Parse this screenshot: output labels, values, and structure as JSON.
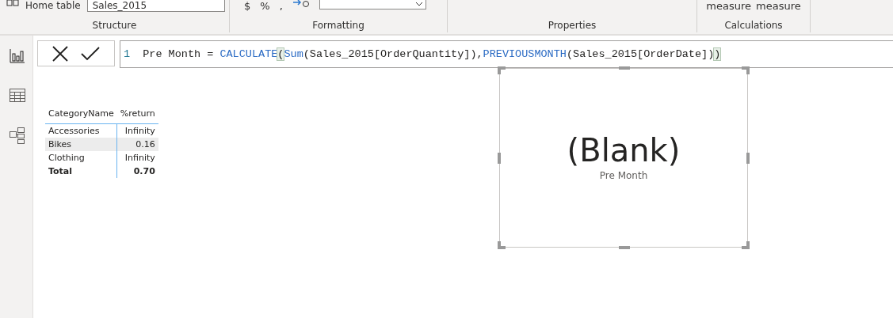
{
  "ribbon": {
    "groups": [
      {
        "kind": "structure",
        "caption": "Structure",
        "label": "Home table",
        "field_value": "Sales_2015"
      },
      {
        "kind": "formatting",
        "caption": "Formatting",
        "symbols": [
          "$",
          "%",
          ","
        ]
      },
      {
        "kind": "properties",
        "caption": "Properties"
      },
      {
        "kind": "calculations",
        "caption": "Calculations",
        "buttons": [
          "measure",
          "measure"
        ]
      }
    ]
  },
  "sidebar": {
    "items": [
      {
        "kind": "report",
        "selected": true
      },
      {
        "kind": "data",
        "selected": false
      },
      {
        "kind": "model",
        "selected": false
      }
    ]
  },
  "formula_bar": {
    "line_number": "1",
    "tokens": [
      {
        "kind": "plain",
        "text": "Pre Month = "
      },
      {
        "kind": "function",
        "text": "CALCULATE"
      },
      {
        "kind": "match",
        "text": "("
      },
      {
        "kind": "function",
        "text": "Sum"
      },
      {
        "kind": "plain",
        "text": "(Sales_2015[OrderQuantity]),"
      },
      {
        "kind": "function",
        "text": "PREVIOUSMONTH"
      },
      {
        "kind": "plain",
        "text": "(Sales_2015[OrderDate])"
      },
      {
        "kind": "match",
        "text": ")"
      }
    ]
  },
  "table": {
    "columns": [
      "CategoryName",
      "%return"
    ],
    "rows": [
      {
        "cells": [
          "Accessories",
          "Infinity"
        ],
        "selected": false
      },
      {
        "cells": [
          "Bikes",
          "0.16"
        ],
        "selected": true
      },
      {
        "cells": [
          "Clothing",
          "Infinity"
        ],
        "selected": false
      }
    ],
    "total": [
      "Total",
      "0.70"
    ]
  },
  "card": {
    "value": "(Blank)",
    "label": "Pre Month"
  }
}
